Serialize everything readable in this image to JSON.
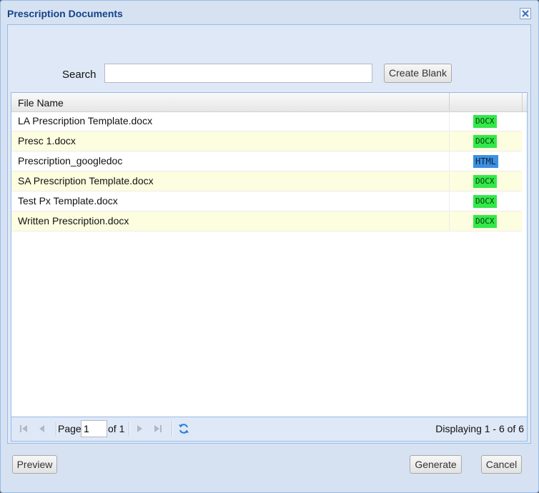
{
  "window": {
    "title": "Prescription Documents"
  },
  "search": {
    "label": "Search",
    "value": "",
    "create_label": "Create Blank"
  },
  "grid": {
    "columns": [
      "File Name",
      ""
    ],
    "rows": [
      {
        "name": "LA Prescription Template.docx",
        "type": "DOCX"
      },
      {
        "name": "Presc 1.docx",
        "type": "DOCX"
      },
      {
        "name": "Prescription_googledoc",
        "type": "HTML"
      },
      {
        "name": "SA Prescription Template.docx",
        "type": "DOCX"
      },
      {
        "name": "Test Px Template.docx",
        "type": "DOCX"
      },
      {
        "name": "Written Prescription.docx",
        "type": "DOCX"
      }
    ]
  },
  "pager": {
    "page_label": "Page",
    "page_value": "1",
    "of_label": "of 1",
    "display_text": "Displaying 1 - 6 of 6"
  },
  "footer": {
    "preview_label": "Preview",
    "generate_label": "Generate",
    "cancel_label": "Cancel"
  },
  "colors": {
    "title": "#15428b",
    "docx_badge": "#33e84a",
    "html_badge": "#3d8fe0",
    "alt_row": "#fdfde0"
  },
  "icons": {
    "close": "close-icon",
    "first": "first-page-icon",
    "prev": "previous-page-icon",
    "next": "next-page-icon",
    "last": "last-page-icon",
    "refresh": "refresh-icon"
  }
}
